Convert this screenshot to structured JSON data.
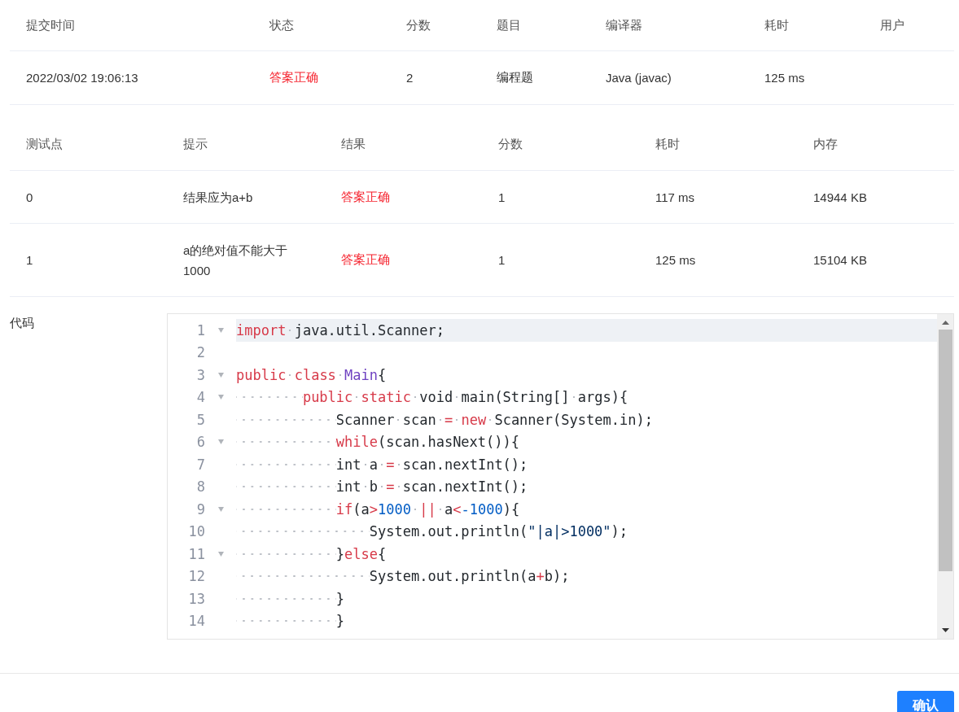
{
  "submission": {
    "columns": [
      "提交时间",
      "状态",
      "分数",
      "题目",
      "编译器",
      "耗时",
      "用户"
    ],
    "row": {
      "time": "2022/03/02 19:06:13",
      "status": "答案正确",
      "score": "2",
      "problem": "编程题",
      "compiler": "Java (javac)",
      "elapsed": "125 ms"
    }
  },
  "testcases": {
    "columns": [
      "测试点",
      "提示",
      "结果",
      "分数",
      "耗时",
      "内存"
    ],
    "rows": [
      {
        "id": "0",
        "hint": "结果应为a+b",
        "result": "答案正确",
        "score": "1",
        "elapsed": "117 ms",
        "memory": "14944 KB"
      },
      {
        "id": "1",
        "hint": "a的绝对值不能大于1000",
        "result": "答案正确",
        "score": "1",
        "elapsed": "125 ms",
        "memory": "15104 KB"
      }
    ]
  },
  "code": {
    "label": "代码",
    "lines": [
      {
        "number": "1",
        "foldable": true,
        "active": true,
        "tokens": [
          {
            "text": "import",
            "kind": "keyword"
          },
          {
            "text": " java.util.Scanner;",
            "kind": "plain"
          }
        ]
      },
      {
        "number": "2",
        "foldable": false,
        "active": false
      },
      {
        "number": "3",
        "foldable": true,
        "active": false,
        "tokens": [
          {
            "text": "public class ",
            "kind": "keyword"
          },
          {
            "text": "Main",
            "kind": "type"
          },
          {
            "text": "{",
            "kind": "plain"
          }
        ]
      },
      {
        "number": "4",
        "foldable": true,
        "active": false,
        "tokens": [
          {
            "text": "        public static",
            "kind": "keyword"
          },
          {
            "text": " void main(String[] args){",
            "kind": "plain"
          }
        ]
      },
      {
        "number": "5",
        "foldable": false,
        "active": false,
        "tokens": [
          {
            "text": "            Scanner scan ",
            "kind": "plain"
          },
          {
            "text": "= ",
            "kind": "operator"
          },
          {
            "text": "new",
            "kind": "keyword"
          },
          {
            "text": " Scanner(System.in);",
            "kind": "plain"
          }
        ]
      },
      {
        "number": "6",
        "foldable": true,
        "active": false,
        "tokens": [
          {
            "text": "            while",
            "kind": "keyword"
          },
          {
            "text": "(scan.hasNext()){",
            "kind": "plain"
          }
        ]
      },
      {
        "number": "7",
        "foldable": false,
        "active": false,
        "tokens": [
          {
            "text": "            int a ",
            "kind": "plain"
          },
          {
            "text": "=",
            "kind": "operator"
          },
          {
            "text": " scan.nextInt();",
            "kind": "plain"
          }
        ]
      },
      {
        "number": "8",
        "foldable": false,
        "active": false,
        "tokens": [
          {
            "text": "            int b ",
            "kind": "plain"
          },
          {
            "text": "=",
            "kind": "operator"
          },
          {
            "text": " scan.nextInt();",
            "kind": "plain"
          }
        ]
      },
      {
        "number": "9",
        "foldable": true,
        "active": false,
        "tokens": [
          {
            "text": "            if",
            "kind": "keyword"
          },
          {
            "text": "(a",
            "kind": "plain"
          },
          {
            "text": ">",
            "kind": "operator"
          },
          {
            "text": "1000 ",
            "kind": "number"
          },
          {
            "text": "||",
            "kind": "operator"
          },
          {
            "text": " a",
            "kind": "plain"
          },
          {
            "text": "<",
            "kind": "operator"
          },
          {
            "text": "-1000",
            "kind": "number"
          },
          {
            "text": "){",
            "kind": "plain"
          }
        ]
      },
      {
        "number": "10",
        "foldable": false,
        "active": false,
        "tokens": [
          {
            "text": "                System.out.println(",
            "kind": "plain"
          },
          {
            "text": "\"|a|>1000\"",
            "kind": "string"
          },
          {
            "text": ");",
            "kind": "plain"
          }
        ]
      },
      {
        "number": "11",
        "foldable": true,
        "active": false,
        "tokens": [
          {
            "text": "            }",
            "kind": "plain"
          },
          {
            "text": "else",
            "kind": "keyword"
          },
          {
            "text": "{",
            "kind": "plain"
          }
        ]
      },
      {
        "number": "12",
        "foldable": false,
        "active": false,
        "tokens": [
          {
            "text": "                System.out.println(a",
            "kind": "plain"
          },
          {
            "text": "+",
            "kind": "operator"
          },
          {
            "text": "b);",
            "kind": "plain"
          }
        ]
      },
      {
        "number": "13",
        "foldable": false,
        "active": false,
        "tokens": [
          {
            "text": "            }",
            "kind": "plain"
          }
        ]
      },
      {
        "number": "14",
        "foldable": false,
        "active": false,
        "tokens": [
          {
            "text": "            }",
            "kind": "plain"
          }
        ]
      }
    ]
  },
  "confirm_button": "确认"
}
